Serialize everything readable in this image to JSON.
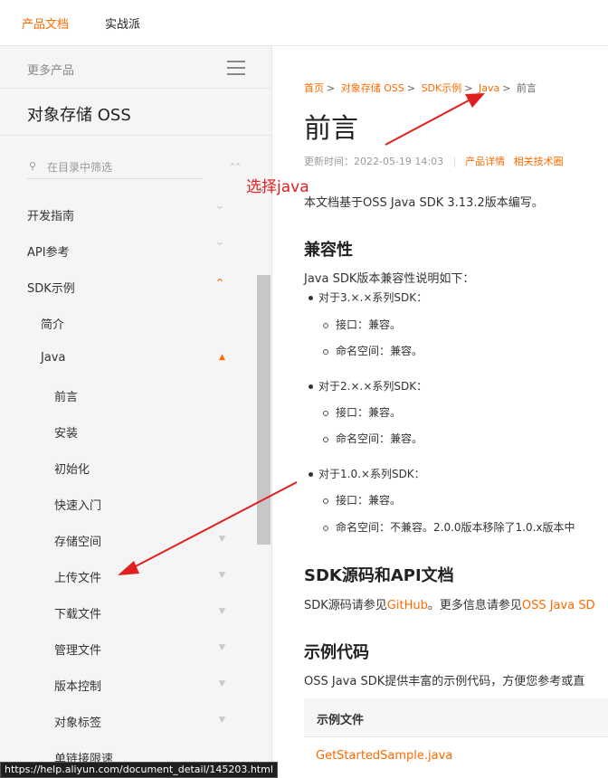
{
  "topbar": {
    "tab_docs": "产品文档",
    "tab_practice": "实战派"
  },
  "sidebar": {
    "more_products": "更多产品",
    "product_title": "对象存储 OSS",
    "filter_placeholder": "在目录中筛选",
    "items": [
      {
        "label": "开发指南"
      },
      {
        "label": "API参考"
      },
      {
        "label": "SDK示例"
      },
      {
        "label": "简介"
      },
      {
        "label": "Java"
      },
      {
        "label": "前言"
      },
      {
        "label": "安装"
      },
      {
        "label": "初始化"
      },
      {
        "label": "快速入门"
      },
      {
        "label": "存储空间"
      },
      {
        "label": "上传文件"
      },
      {
        "label": "下载文件"
      },
      {
        "label": "管理文件"
      },
      {
        "label": "版本控制"
      },
      {
        "label": "对象标签"
      },
      {
        "label": "单链接限速"
      }
    ]
  },
  "breadcrumb": {
    "home": "首页",
    "oss": "对象存储 OSS",
    "sdk": "SDK示例",
    "java": "Java",
    "current": "前言"
  },
  "page": {
    "title": "前言",
    "updated": "更新时间：2022-05-19 14:03",
    "product_details": "产品详情",
    "related_tech": "相关技术圈",
    "intro": "本文档基于OSS Java SDK 3.13.2版本编写。",
    "compat_heading": "兼容性",
    "compat_desc": "Java SDK版本兼容性说明如下：",
    "v3": "对于3.×.×系列SDK：",
    "v3_api": "接口：兼容。",
    "v3_ns": "命名空间：兼容。",
    "v2": "对于2.×.×系列SDK：",
    "v2_api": "接口：兼容。",
    "v2_ns": "命名空间：兼容。",
    "v1": "对于1.0.×系列SDK：",
    "v1_api": "接口：兼容。",
    "v1_ns": "命名空间：不兼容。2.0.0版本移除了1.0.x版本中",
    "src_heading": "SDK源码和API文档",
    "src_desc": "SDK源码请参见",
    "src_link": "GitHub",
    "src_desc2": "。更多信息请参见",
    "src_link2": "OSS Java SD",
    "example_heading": "示例代码",
    "example_desc": "OSS Java SDK提供丰富的示例代码，方便您参考或直",
    "table_header": "示例文件",
    "table_first": "GetStartedSample.java"
  },
  "annotation": {
    "label": "选择java"
  },
  "statusbar": {
    "url": "https://help.aliyun.com/document_detail/145203.html"
  },
  "colors": {
    "accent": "#ff6a00",
    "annotation": "#e02020",
    "sidebar_bg": "#f5f5f6"
  }
}
